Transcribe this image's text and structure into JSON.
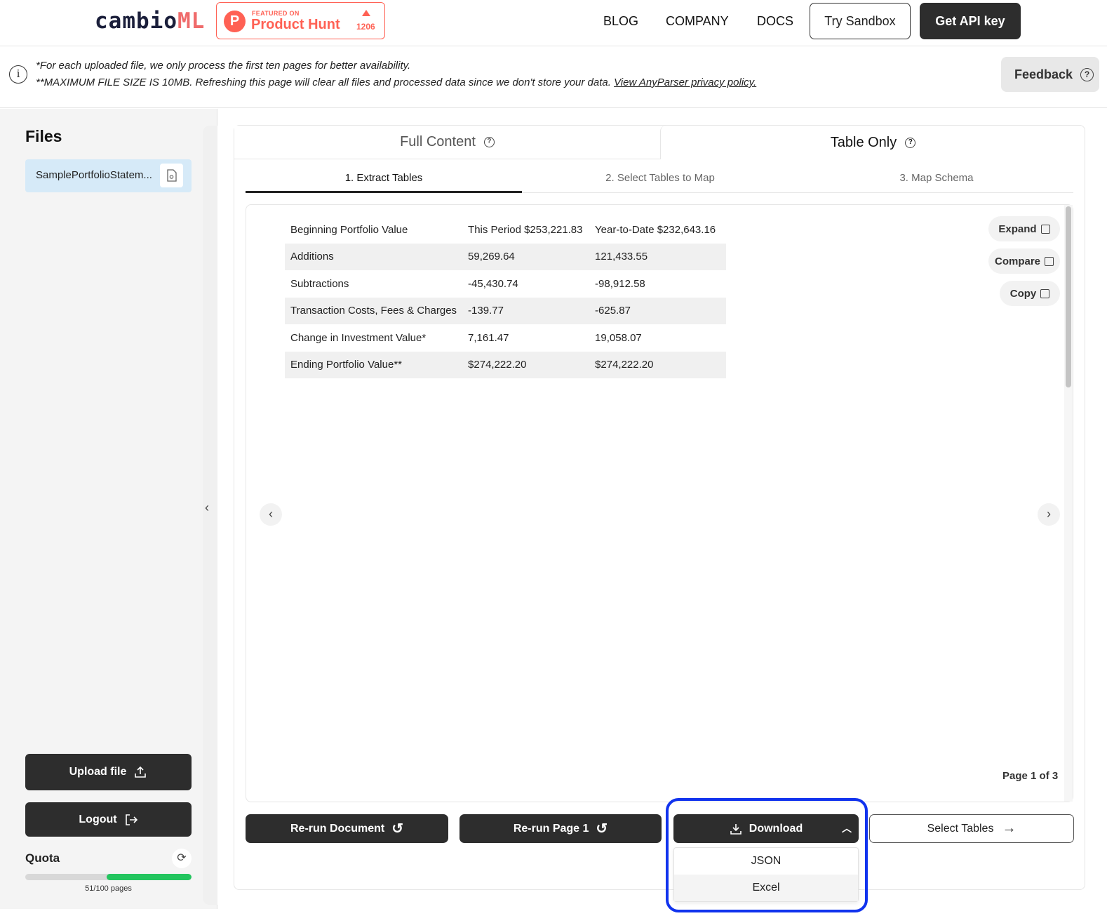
{
  "header": {
    "logo_main": "cambio",
    "logo_accent": "ML",
    "producthunt": {
      "featured": "FEATURED ON",
      "name": "Product Hunt",
      "count": "1206",
      "letter": "P"
    },
    "nav": {
      "blog": "BLOG",
      "company": "COMPANY",
      "docs": "DOCS"
    },
    "try_sandbox": "Try Sandbox",
    "get_api_key": "Get API key"
  },
  "notice": {
    "line1": "*For each uploaded file, we only process the first ten pages for better availability.",
    "line2": "**MAXIMUM FILE SIZE IS 10MB. Refreshing this page will clear all files and processed data since we don't store your data.",
    "privacy_link": "View AnyParser privacy policy.",
    "info_glyph": "i"
  },
  "feedback": {
    "label": "Feedback",
    "glyph": "?"
  },
  "sidebar": {
    "title": "Files",
    "file_name": "SamplePortfolioStatem...",
    "upload_label": "Upload file",
    "logout_label": "Logout",
    "quota_title": "Quota",
    "quota_text": "51/100 pages",
    "quota_fraction": 0.51
  },
  "tabs": {
    "full_content": "Full Content",
    "table_only": "Table Only",
    "q_glyph": "?"
  },
  "steps": {
    "step1": "1. Extract Tables",
    "step2": "2. Select Tables to Map",
    "step3": "3. Map Schema"
  },
  "table": {
    "rows": [
      [
        "Beginning Portfolio Value",
        "This Period $253,221.83",
        "Year-to-Date $232,643.16"
      ],
      [
        "Additions",
        "59,269.64",
        "121,433.55"
      ],
      [
        "Subtractions",
        "-45,430.74",
        "-98,912.58"
      ],
      [
        "Transaction Costs, Fees & Charges",
        "-139.77",
        "-625.87"
      ],
      [
        "Change in Investment Value*",
        "7,161.47",
        "19,058.07"
      ],
      [
        "Ending Portfolio Value**",
        "$274,222.20",
        "$274,222.20"
      ]
    ]
  },
  "side_actions": {
    "expand": "Expand",
    "compare": "Compare",
    "copy": "Copy"
  },
  "pager": {
    "page_label": "Page 1 of 3",
    "prev": "‹",
    "next": "›"
  },
  "actions": {
    "rerun_document": "Re-run Document",
    "rerun_page": "Re-run Page 1",
    "download": "Download",
    "select_tables": "Select Tables"
  },
  "download_menu": {
    "json": "JSON",
    "excel": "Excel"
  },
  "colors": {
    "accent_blue": "#1133ee",
    "quota_green": "#22c55e",
    "ph_orange": "#ff6154",
    "dark_button": "#2d2d2d"
  }
}
